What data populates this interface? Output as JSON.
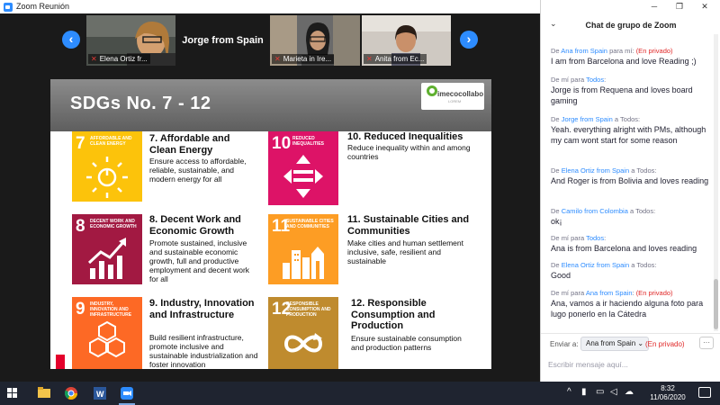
{
  "window": {
    "title": "Zoom Reunión"
  },
  "gallery": {
    "tiles": [
      {
        "label": "Elena Ortiz fr..."
      },
      {
        "label": "Jorge from Spain"
      },
      {
        "label": "Marieta in Ire..."
      },
      {
        "label": "Anita from Ec..."
      }
    ],
    "prev_icon": "chevron-left-icon",
    "next_icon": "chevron-right-icon"
  },
  "slide": {
    "title": "SDGs No. 7 - 12",
    "logo": {
      "text": "imecocollabo",
      "sub": "LOREM"
    },
    "goals": [
      {
        "num": "7",
        "cap": "AFFORDABLE AND CLEAN ENERGY",
        "color": "#FCC30B",
        "title": "7. Affordable and Clean Energy",
        "desc": "Ensure access to affordable, reliable, sustainable, and modern energy for all"
      },
      {
        "num": "8",
        "cap": "DECENT WORK AND ECONOMIC GROWTH",
        "color": "#A21942",
        "title": "8. Decent Work and Economic Growth",
        "desc": "Promote sustained, inclusive and sustainable economic growth, full and productive employment and decent work for all"
      },
      {
        "num": "9",
        "cap": "INDUSTRY, INNOVATION AND INFRASTRUCTURE",
        "color": "#FD6925",
        "title": "9. Industry, Innovation and Infrastructure",
        "desc": "Build resilient infrastructure, promote inclusive and sustainable industrialization and foster innovation"
      },
      {
        "num": "10",
        "cap": "REDUCED INEQUALITIES",
        "color": "#DD1367",
        "title": "10. Reduced Inequalities",
        "desc": "Reduce inequality within and among countries"
      },
      {
        "num": "11",
        "cap": "SUSTAINABLE CITIES AND COMMUNITIES",
        "color": "#FD9D24",
        "title": "11. Sustainable Cities and Communities",
        "desc": "Make cities and human settlement inclusive, safe, resilient and sustainable"
      },
      {
        "num": "12",
        "cap": "RESPONSIBLE CONSUMPTION AND PRODUCTION",
        "color": "#BF8B2E",
        "title": "12. Responsible Consumption and Production",
        "desc": "Ensure sustainable consumption and production patterns"
      }
    ]
  },
  "chat": {
    "title": "Chat de grupo de Zoom",
    "messages": [
      {
        "meta_pre": "De",
        "from": "Ana from Spain",
        "meta_mid": "para",
        "to": "mí",
        "private": "(En privado)",
        "text": "I am from Barcelona and love Reading ;)"
      },
      {
        "meta_pre": "De",
        "from": "mí",
        "meta_mid": "para",
        "to": "Todos",
        "private": "",
        "text": "Jorge is from Requena and loves board gaming"
      },
      {
        "meta_pre": "De",
        "from": "Jorge from Spain",
        "meta_mid": "a",
        "to": "Todos",
        "private": "",
        "text": "Yeah. everything alright with PMs, although my cam wont start for some reason"
      },
      {
        "meta_pre": "De",
        "from": "Elena Ortiz from Spain",
        "meta_mid": "a",
        "to": "Todos",
        "private": "",
        "text": "And Roger is from Bolivia and loves reading"
      },
      {
        "meta_pre": "De",
        "from": "Camilo from Colombia",
        "meta_mid": "a",
        "to": "Todos",
        "private": "",
        "text": "ok¡"
      },
      {
        "meta_pre": "De",
        "from": "mí",
        "meta_mid": "para",
        "to": "Todos",
        "private": "",
        "text": "Ana is from Barcelona and loves reading"
      },
      {
        "meta_pre": "De",
        "from": "Elena Ortiz from Spain",
        "meta_mid": "a",
        "to": "Todos",
        "private": "",
        "text": "Good"
      },
      {
        "meta_pre": "De",
        "from": "mí",
        "meta_mid": "para",
        "to": "Ana from Spain",
        "private": "(En privado)",
        "text": "Ana, vamos a ir haciendo alguna foto para lugo ponerlo en la Cátedra"
      }
    ],
    "send_to_label": "Enviar a:",
    "send_to_value": "Ana from Spain",
    "send_private": "(En privado)",
    "more_label": "···",
    "input_placeholder": "Escribir mensaje aquí..."
  },
  "taskbar": {
    "apps": [
      "windows-start",
      "file-explorer",
      "chrome",
      "word",
      "zoom"
    ],
    "time": "8:32",
    "date": "11/06/2020"
  }
}
